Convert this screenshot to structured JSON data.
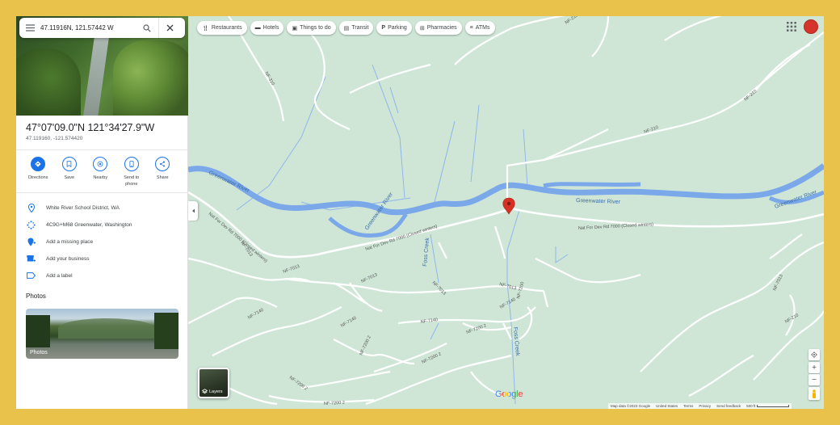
{
  "search": {
    "value": "47.11916N, 121.57442 W"
  },
  "place": {
    "title": "47°07'09.0\"N 121°34'27.9\"W",
    "decimal": "47.119160, -121.574420"
  },
  "actions": [
    {
      "label": "Directions",
      "icon": "directions-icon"
    },
    {
      "label": "Save",
      "icon": "bookmark-icon"
    },
    {
      "label": "Nearby",
      "icon": "nearby-icon"
    },
    {
      "label": "Send to phone",
      "icon": "phone-icon"
    },
    {
      "label": "Share",
      "icon": "share-icon"
    }
  ],
  "info": [
    {
      "text": "White River School District, WA",
      "icon": "location-pin-icon"
    },
    {
      "text": "4C9G+M68 Greenwater, Washington",
      "icon": "plus-code-icon"
    },
    {
      "text": "Add a missing place",
      "icon": "add-place-icon"
    },
    {
      "text": "Add your business",
      "icon": "business-icon"
    },
    {
      "text": "Add a label",
      "icon": "label-icon"
    }
  ],
  "photos": {
    "heading": "Photos",
    "card_label": "Photos"
  },
  "chips": [
    {
      "label": "Restaurants",
      "icon": "restaurant-icon"
    },
    {
      "label": "Hotels",
      "icon": "hotel-icon"
    },
    {
      "label": "Things to do",
      "icon": "camera-icon"
    },
    {
      "label": "Transit",
      "icon": "transit-icon"
    },
    {
      "label": "Parking",
      "icon": "parking-icon"
    },
    {
      "label": "Pharmacies",
      "icon": "pharmacy-icon"
    },
    {
      "label": "ATMs",
      "icon": "atm-icon"
    }
  ],
  "layers": {
    "label": "Layers"
  },
  "logo": {
    "text": "Google",
    "colors": [
      "#4285F4",
      "#EA4335",
      "#FBBC05",
      "#4285F4",
      "#34A853",
      "#EA4335"
    ]
  },
  "footer": {
    "map_data": "Map data ©2023 Google",
    "country": "United States",
    "terms": "Terms",
    "privacy": "Privacy",
    "feedback": "Send feedback",
    "scale": "500 ft"
  },
  "map": {
    "road_labels": [
      "NF-210",
      "NF-310",
      "NF-210",
      "NF-210",
      "Nat For Dev Rd 7000 (Closed winters)",
      "Nat For Dev Rd 7000 (Closed winters)",
      "Nat For Dev Rd 7000 (Closed winters)",
      "NF-7013",
      "NF-7013",
      "NF-7013",
      "NF-7013",
      "NF-7140",
      "NF-7140",
      "NF-7140",
      "NF-7140",
      "NF-7200",
      "NF-7200 2",
      "NF-7200 2",
      "NF-7200 2",
      "NF-7200 2",
      "NF-7200 2",
      "NF-7013",
      "NF-7013",
      "NF-210"
    ],
    "river_labels": [
      "Greenwater River",
      "Greenwater River",
      "Greenwater River",
      "Greenwater River"
    ],
    "creek_labels": [
      "Foss Creek",
      "Foss Creek"
    ],
    "colors": {
      "land": "#cfe6d7",
      "water": "#7aa8e8",
      "road": "#ffffff",
      "pin": "#d93025"
    }
  }
}
